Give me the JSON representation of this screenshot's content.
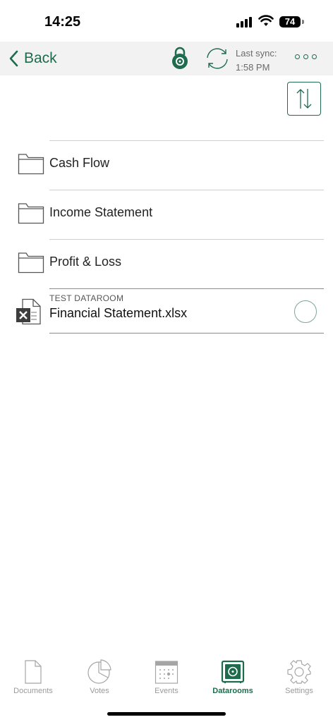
{
  "status_bar": {
    "time": "14:25",
    "battery": "74"
  },
  "nav": {
    "back_label": "Back",
    "sync_line1": "Last sync:",
    "sync_line2": "1:58 PM"
  },
  "colors": {
    "accent": "#1e6b4d"
  },
  "items": [
    {
      "type": "folder",
      "label": "Cash Flow"
    },
    {
      "type": "folder",
      "label": "Income Statement"
    },
    {
      "type": "folder",
      "label": "Profit & Loss"
    }
  ],
  "file": {
    "caption": "TEST DATAROOM",
    "name": "Financial Statement.xlsx",
    "icon": "excel-icon"
  },
  "tabs": [
    {
      "label": "Documents",
      "icon": "document-icon"
    },
    {
      "label": "Votes",
      "icon": "pie-chart-icon"
    },
    {
      "label": "Events",
      "icon": "calendar-icon"
    },
    {
      "label": "Datarooms",
      "icon": "vault-icon",
      "active": true
    },
    {
      "label": "Settings",
      "icon": "gear-icon"
    }
  ]
}
